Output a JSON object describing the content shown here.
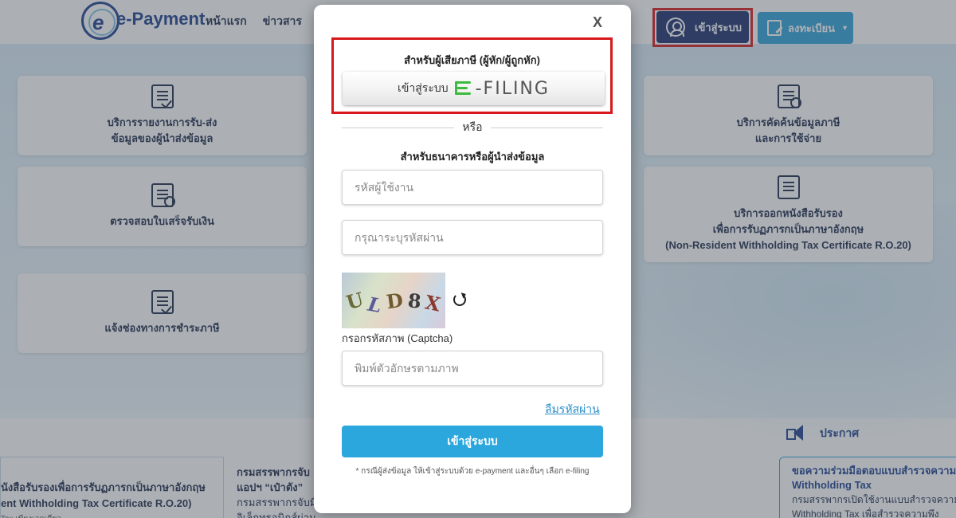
{
  "header": {
    "logo_text": "e-Payment",
    "logo_letter": "e",
    "nav": [
      "หน้าแรก",
      "ข่าวสาร"
    ],
    "login_label": "เข้าสู่ระบบ",
    "register_label": "ลงทะเบียน"
  },
  "services": {
    "left": [
      {
        "line1": "บริการรายงานการรับ-ส่ง",
        "line2": "ข้อมูลของผู้นำส่งข้อมูล",
        "line3": ""
      },
      {
        "line1": "ตรวจสอบใบเสร็จรับเงิน",
        "line2": "",
        "line3": ""
      },
      {
        "line1": "แจ้งช่องทางการชำระภาษี",
        "line2": "",
        "line3": ""
      }
    ],
    "right": [
      {
        "line1": "บริการคัดค้นข้อมูลภาษี",
        "line2": "และการใช้จ่าย",
        "line3": ""
      },
      {
        "line1": "บริการออกหนังสือรับรอง",
        "line2": "เพื่อการรับฏภารกเป็นภาษาอังกฤษ",
        "line3": "(Non-Resident Withholding Tax Certificate R.O.20)"
      }
    ]
  },
  "announcement": {
    "label": "ประกาศ"
  },
  "news": {
    "left_line1": "นังสือรับรองเพื่อการรับฏภารกเป็นภาษาอังกฤษ",
    "left_line2": "ent Withholding Tax Certificate R.O.20)",
    "left_line3": "Tax เพียงเอกเดียว",
    "mid_line1": "กรมสรรพากรจับ",
    "mid_line2": "แอปฯ “เป๋าตัง”",
    "mid_line3": "กรมสรรพากรจับมือ",
    "mid_line4": "อิเล็กทรอนิกส์ผ่านแอปฯ เป๋าตัง",
    "right_line1": "ขอความร่วมมือตอบแบบสำรวจความ",
    "right_line2": "Withholding Tax",
    "right_line3": "กรมสรรพากรเปิดใช้งานแบบสำรวจความ",
    "right_line4": "Withholding Tax เพื่อสำรวจความพึง"
  },
  "modal": {
    "close_label": "X",
    "efiling_title": "สำหรับผู้เสียภาษี (ผู้หัก/ผู้ถูกหัก)",
    "efiling_btn_label": "เข้าสู่ระบบ",
    "efiling_logo_text": "-FILING",
    "or_text": "หรือ",
    "bank_title": "สำหรับธนาคารหรือผู้นำส่งข้อมูล",
    "username_placeholder": "รหัสผู้ใช้งาน",
    "password_placeholder": "กรุณาระบุรหัสผ่าน",
    "captcha_chars": [
      {
        "ch": "U",
        "color": "#6b6b3a"
      },
      {
        "ch": "L",
        "color": "#5b5b9b"
      },
      {
        "ch": "D",
        "color": "#6e5a2e"
      },
      {
        "ch": "8",
        "color": "#3c3c3c"
      },
      {
        "ch": "X",
        "color": "#8a3a2a"
      }
    ],
    "captcha_label": "กรอกรหัสภาพ (Captcha)",
    "captcha_placeholder": "พิมพ์ตัวอักษรตามภาพ",
    "forgot_label": "ลืมรหัสผ่าน",
    "submit_label": "เข้าสู่ระบบ",
    "note": "* กรณีผู้ส่งข้อมูล ให้เข้าสู่ระบบด้วย e-payment และอื่นๆ เลือก e-filing"
  },
  "colors": {
    "primary": "#1d2f6e",
    "accent": "#2ca7dd",
    "highlight": "#d7191b",
    "efiling_green": "#3dbb3d"
  }
}
